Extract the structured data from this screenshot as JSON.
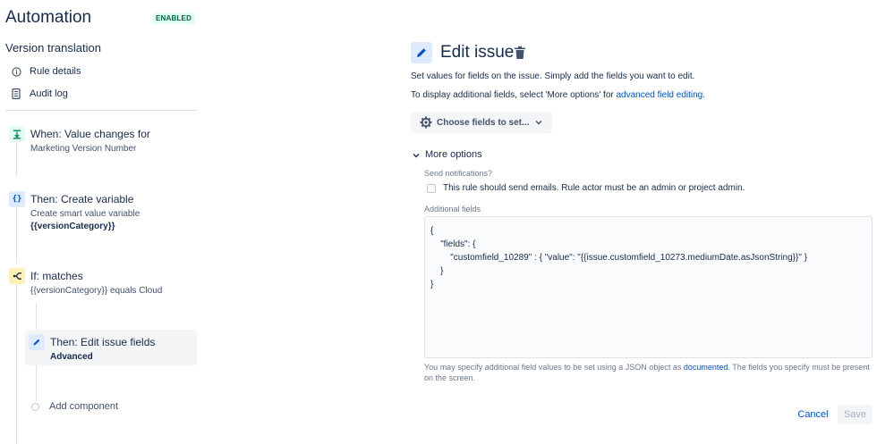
{
  "sidebar": {
    "app_title": "Automation",
    "status_badge": "ENABLED",
    "rule_name": "Version translation",
    "menu": [
      {
        "label": "Rule details",
        "icon": "info-icon"
      },
      {
        "label": "Audit log",
        "icon": "document-icon"
      }
    ],
    "steps": [
      {
        "title": "When: Value changes for",
        "subtitle": "Marketing Version Number",
        "icon": "trigger-icon",
        "color": "#e3fcef"
      },
      {
        "title": "Then: Create variable",
        "subtitle": "Create smart value variable",
        "subtitle2": "{{versionCategory}}",
        "icon": "braces-icon",
        "color": "#deebff"
      },
      {
        "title": "If: matches",
        "subtitle": "{{versionCategory}} equals Cloud",
        "icon": "branch-icon",
        "color": "#fffae6"
      },
      {
        "title": "Then: Edit issue fields",
        "subtitle": "Advanced",
        "icon": "pencil-icon",
        "color": "#deebff"
      }
    ],
    "add_component": "Add component"
  },
  "panel": {
    "title": "Edit issue",
    "desc1": "Set values for fields on the issue. Simply add the fields you want to edit.",
    "desc2_prefix": "To display additional fields, select 'More options' for ",
    "desc2_link": "advanced field editing",
    "desc2_suffix": ".",
    "choose_fields": "Choose fields to set...",
    "more_options": "More options",
    "send_notifications_label": "Send notifications?",
    "send_notifications_checkbox": "This rule should send emails. Rule actor must be an admin or project admin.",
    "additional_fields_label": "Additional fields",
    "json_lines": [
      "{",
      "    \"fields\": {",
      "        \"customfield_10289\" : { \"value\": \"{{issue.customfield_10273.mediumDate.asJsonString}}\" }",
      "    }",
      "}"
    ],
    "help_prefix": "You may specify additional field values to be set using a JSON object as ",
    "help_link": "documented",
    "help_suffix": ". The fields you specify must be present on the screen.",
    "cancel": "Cancel",
    "save": "Save"
  }
}
